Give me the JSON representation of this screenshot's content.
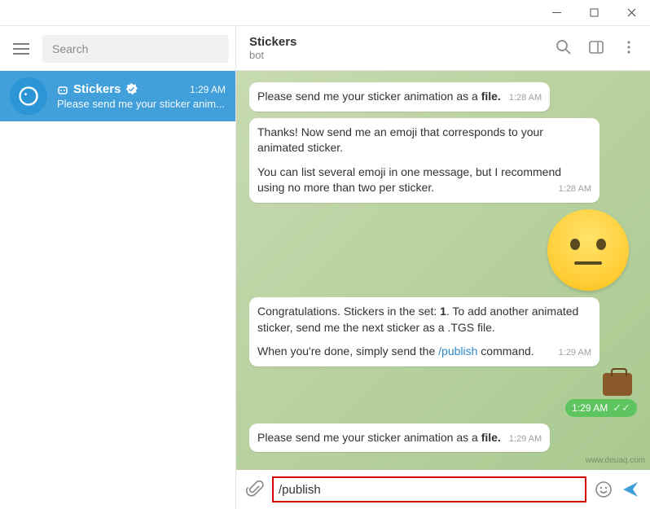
{
  "window": {
    "min": "—",
    "max": "▢",
    "close": "✕"
  },
  "sidebar": {
    "search_placeholder": "Search",
    "item": {
      "name": "Stickers",
      "verified": true,
      "time": "1:29 AM",
      "preview": "Please send me your sticker anim..."
    }
  },
  "header": {
    "title": "Stickers",
    "subtitle": "bot"
  },
  "messages": {
    "m1": {
      "text_a": "Please send me your sticker animation as a ",
      "bold": "file.",
      "time": "1:28 AM"
    },
    "m2": {
      "p1": "Thanks! Now send me an emoji that corresponds to your animated sticker.",
      "p2": "You can list several emoji in one message, but I recommend using no more than two per sticker.",
      "time": "1:28 AM"
    },
    "m3": {
      "p1a": "Congratulations. Stickers in the set: ",
      "p1b": "1",
      "p1c": ". To add another animated sticker, send me the next sticker as a .TGS file.",
      "p2a": "When you're done, simply send the ",
      "link": "/publish",
      "p2b": " command.",
      "time": "1:29 AM"
    },
    "out": {
      "time": "1:29 AM"
    },
    "m4": {
      "text_a": "Please send me your sticker animation as a ",
      "bold": "file.",
      "time": "1:29 AM"
    }
  },
  "compose": {
    "value": "/publish"
  },
  "watermark": "www.deuaq.com"
}
